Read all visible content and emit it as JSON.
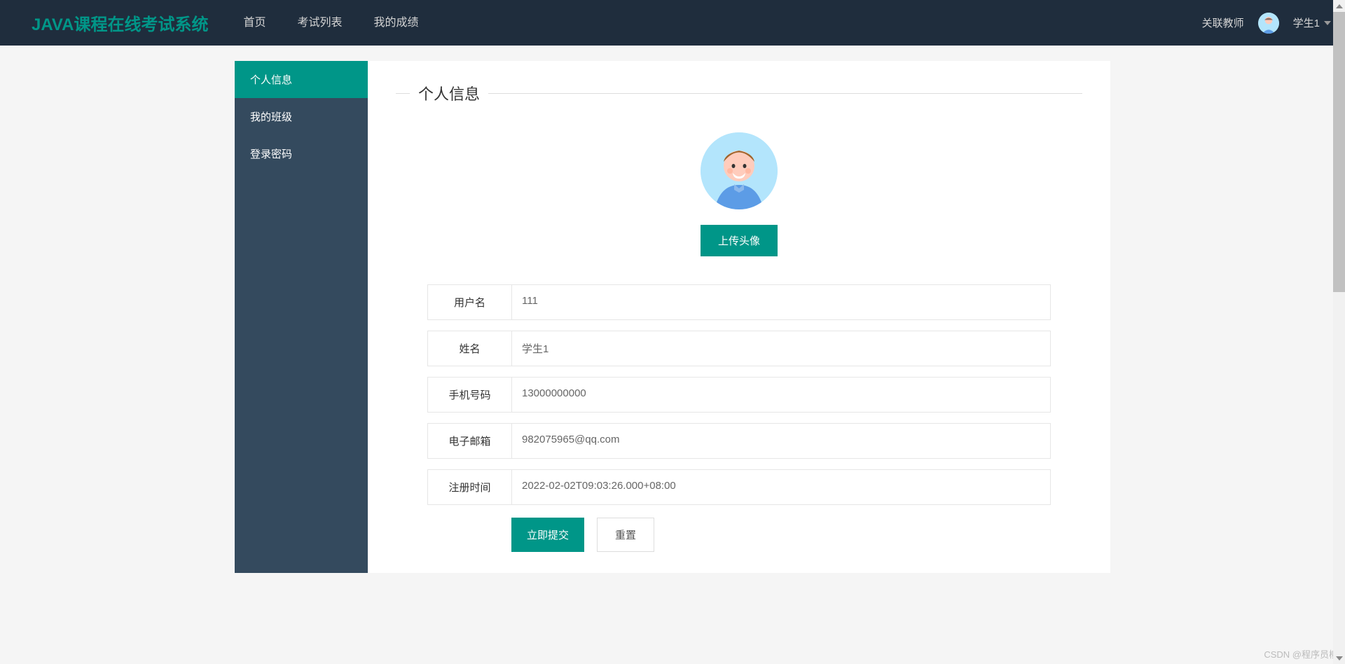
{
  "brand": "JAVA课程在线考试系统",
  "nav": {
    "items": [
      "首页",
      "考试列表",
      "我的成绩"
    ],
    "associate_teacher": "关联教师",
    "username": "学生1"
  },
  "sidebar": {
    "items": [
      {
        "label": "个人信息",
        "active": true
      },
      {
        "label": "我的班级",
        "active": false
      },
      {
        "label": "登录密码",
        "active": false
      }
    ]
  },
  "page": {
    "title": "个人信息",
    "upload_avatar": "上传头像",
    "fields": [
      {
        "label": "用户名",
        "value": "111"
      },
      {
        "label": "姓名",
        "value": "学生1"
      },
      {
        "label": "手机号码",
        "value": "13000000000"
      },
      {
        "label": "电子邮箱",
        "value": "982075965@qq.com"
      },
      {
        "label": "注册时间",
        "value": "2022-02-02T09:03:26.000+08:00"
      }
    ],
    "submit": "立即提交",
    "reset": "重置"
  },
  "watermark": "CSDN @程序员柳"
}
